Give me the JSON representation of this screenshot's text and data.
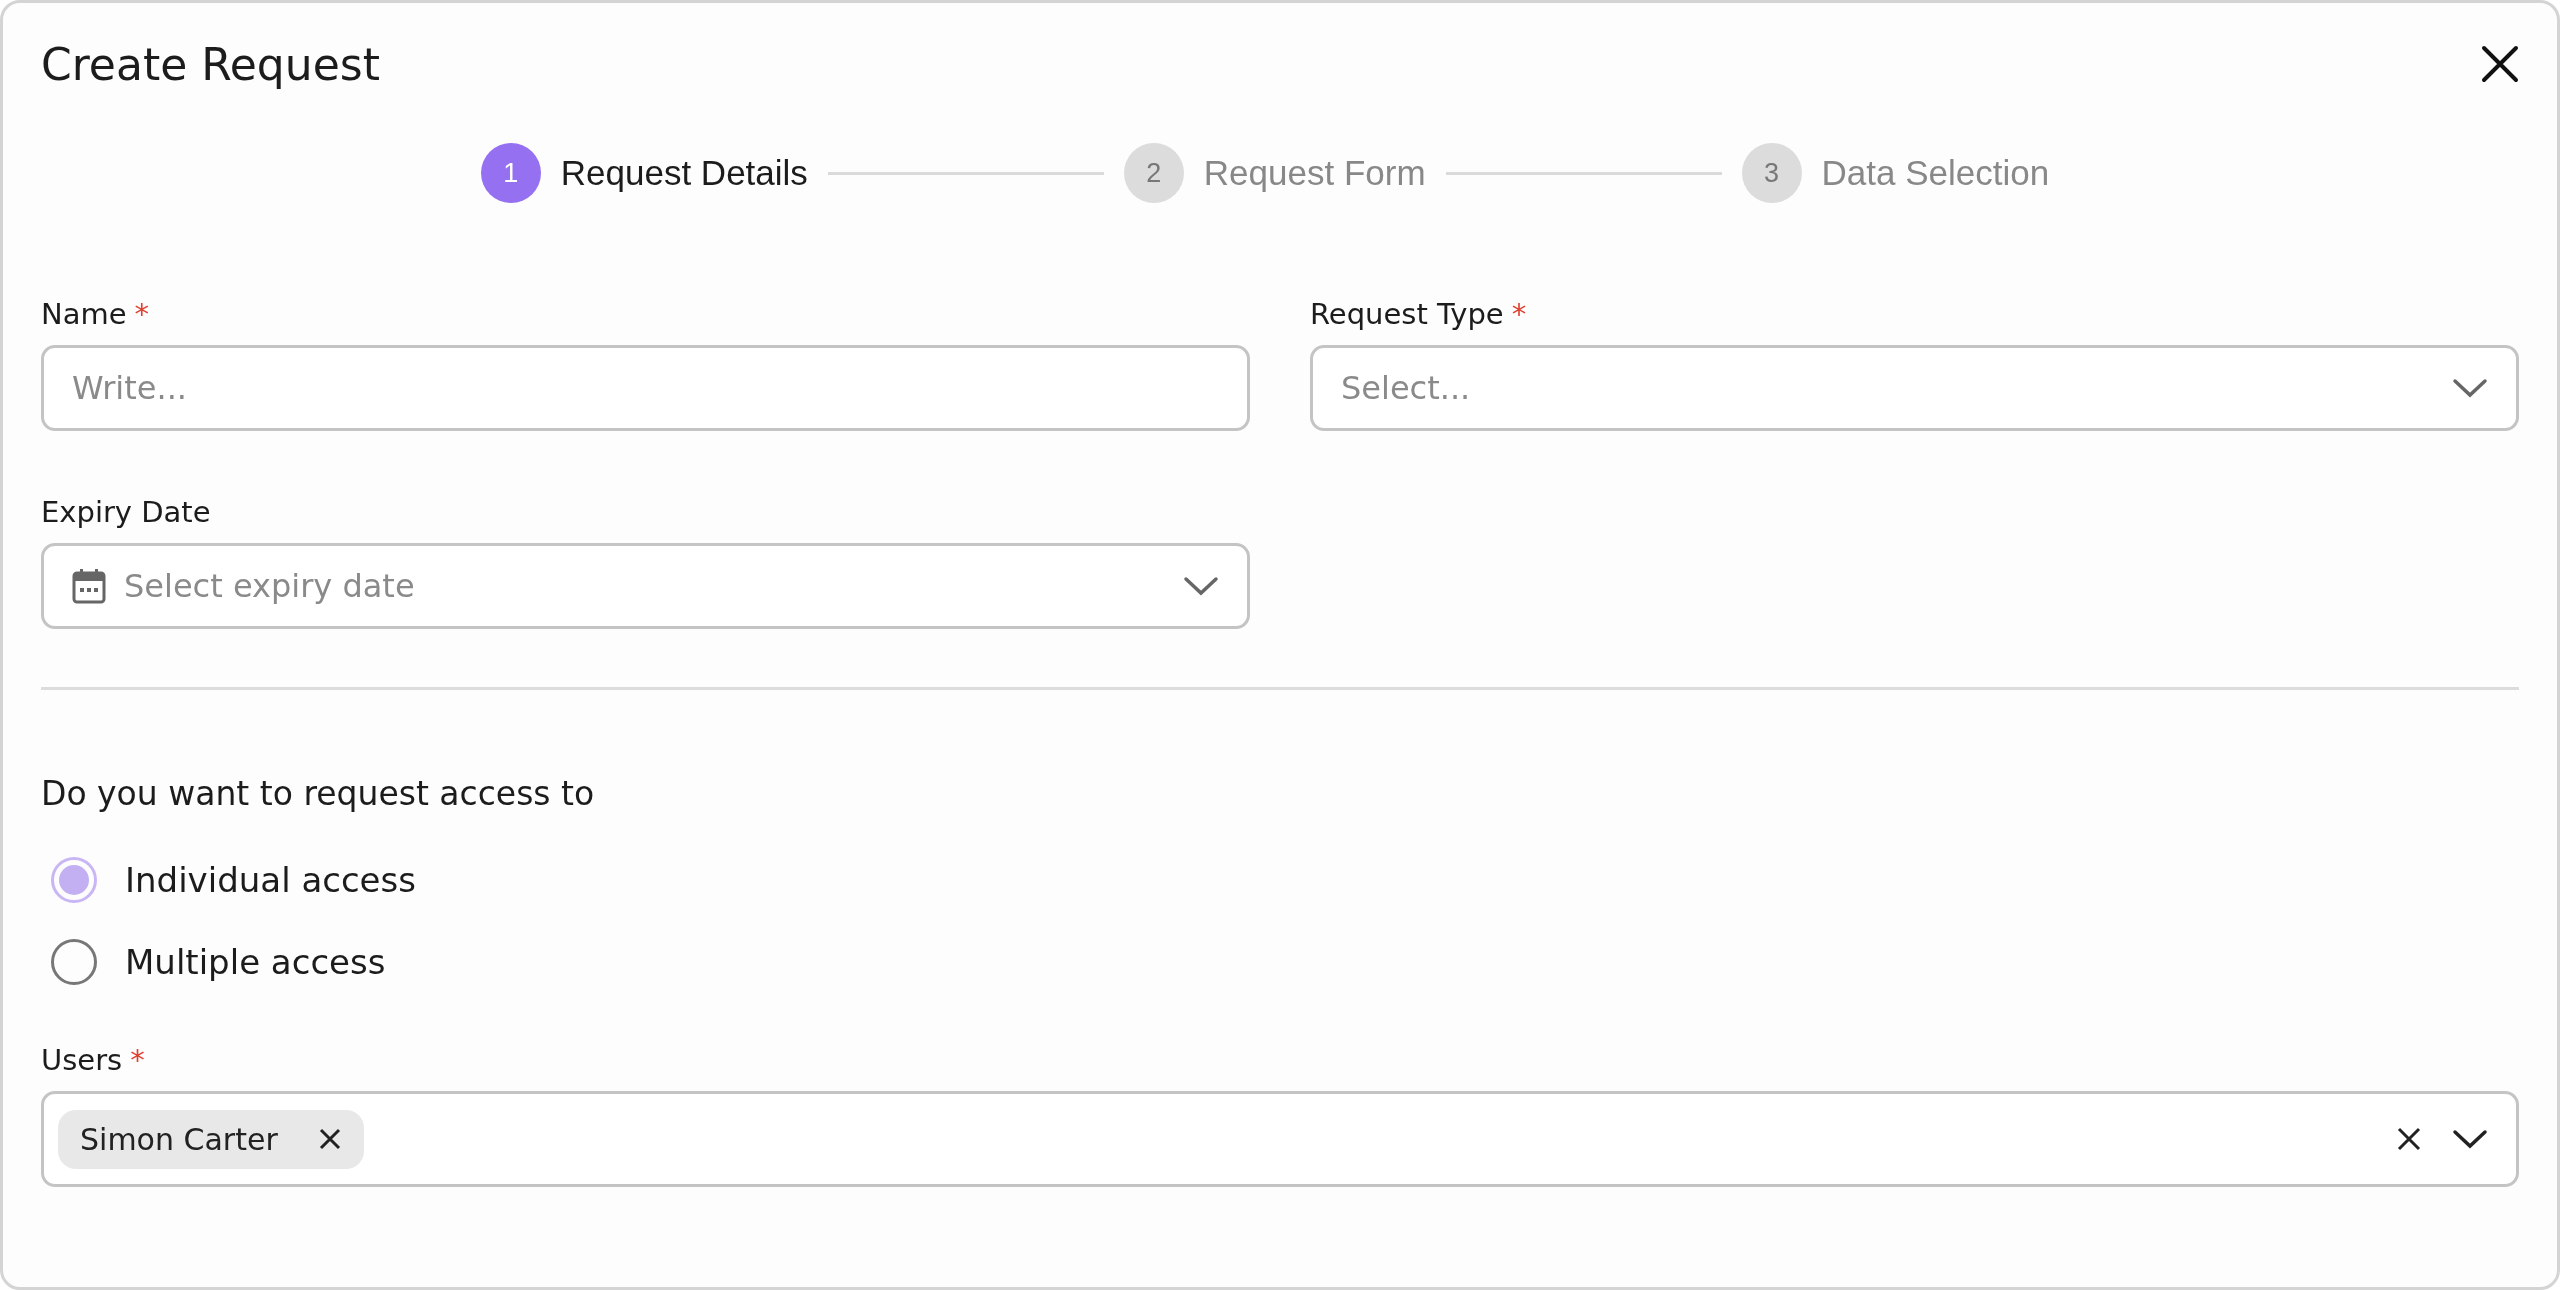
{
  "window": {
    "title": "Create Request"
  },
  "steps": [
    {
      "number": "1",
      "label": "Request Details",
      "selected": true
    },
    {
      "number": "2",
      "label": "Request Form",
      "selected": false
    },
    {
      "number": "3",
      "label": "Data Selection",
      "selected": false
    }
  ],
  "fields_row_1": [
    {
      "kind": "text",
      "label": "Name",
      "required_mark": "*",
      "placeholder": "Write..."
    },
    {
      "kind": "select",
      "label": "Request Type",
      "required_mark": "*",
      "placeholder": "Select..."
    }
  ],
  "expiry": {
    "kind": "date",
    "label": "Expiry Date",
    "placeholder": "Select expiry date"
  },
  "question": "Do you want to request access to",
  "access_options": [
    {
      "label": "Individual access",
      "selected": true
    },
    {
      "label": "Multiple access",
      "selected": false
    }
  ],
  "users": {
    "label": "Users",
    "required_mark": "*",
    "chips": [
      "Simon Carter"
    ]
  }
}
